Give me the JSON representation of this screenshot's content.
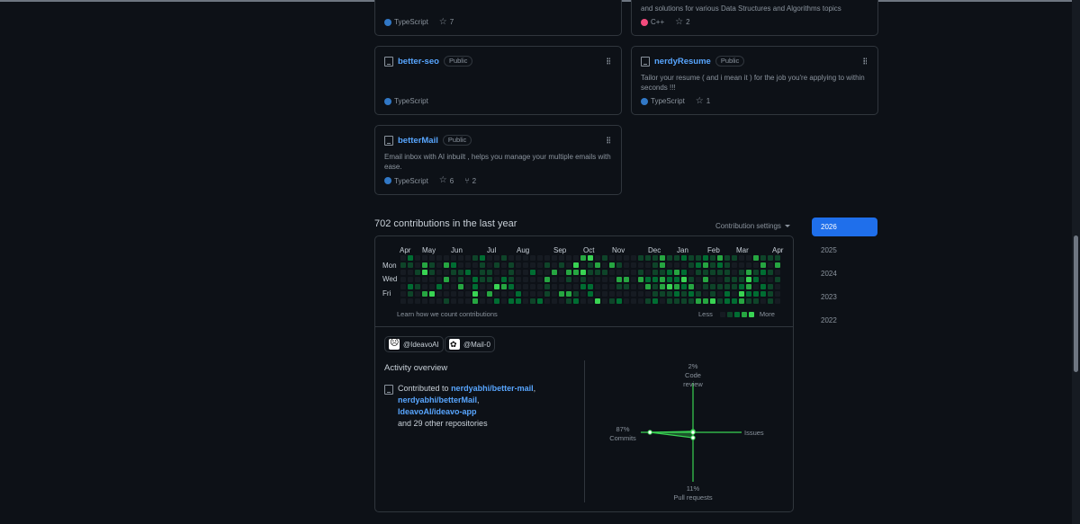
{
  "repos": {
    "top_left": {
      "language": "TypeScript",
      "lang_color": "#3178c6",
      "stars": "7"
    },
    "top_right": {
      "desc": "and solutions for various Data Structures and Algorithms topics",
      "language": "C++",
      "lang_color": "#f34b7d",
      "stars": "2"
    },
    "better_seo": {
      "name": "better-seo",
      "visibility": "Public",
      "language": "TypeScript",
      "lang_color": "#3178c6"
    },
    "nerdy_resume": {
      "name": "nerdyResume",
      "visibility": "Public",
      "desc": "Tailor your resume ( and i mean it ) for the job you're applying to within seconds !!!",
      "language": "TypeScript",
      "lang_color": "#3178c6",
      "stars": "1"
    },
    "better_mail": {
      "name": "betterMail",
      "visibility": "Public",
      "desc": "Email inbox with AI inbuilt , helps you manage your multiple emails with ease.",
      "language": "TypeScript",
      "lang_color": "#3178c6",
      "stars": "6",
      "forks": "2"
    }
  },
  "contributions": {
    "title": "702 contributions in the last year",
    "settings_label": "Contribution settings",
    "months": [
      "Apr",
      "May",
      "Jun",
      "Jul",
      "Aug",
      "Sep",
      "Oct",
      "Nov",
      "Dec",
      "Jan",
      "Feb",
      "Mar",
      "Apr"
    ],
    "day_labels": [
      "Mon",
      "Wed",
      "Fri"
    ],
    "learn_link": "Learn how we count contributions",
    "legend_less": "Less",
    "legend_more": "More",
    "level_colors": [
      "#161b22",
      "#0e4429",
      "#006d32",
      "#26a641",
      "#39d353"
    ]
  },
  "years": [
    "2026",
    "2025",
    "2024",
    "2023",
    "2022"
  ],
  "selected_year": "2026",
  "orgs": [
    {
      "handle": "@IdeavoAI"
    },
    {
      "handle": "@Mail-0"
    }
  ],
  "activity": {
    "title": "Activity overview",
    "contributed_to": "Contributed to",
    "repos": [
      "nerdyabhi/better-mail",
      "nerdyabhi/betterMail",
      "IdeavoAI/ideavo-app"
    ],
    "others": "and 29 other repositories",
    "radar": {
      "code_review": {
        "pct": "2%",
        "label": "Code review",
        "value": 2
      },
      "issues": {
        "pct": "",
        "label": "Issues",
        "value": 0
      },
      "pull_requests": {
        "pct": "11%",
        "label": "Pull requests",
        "value": 11
      },
      "commits": {
        "pct": "87%",
        "label": "Commits",
        "value": 87
      }
    }
  }
}
